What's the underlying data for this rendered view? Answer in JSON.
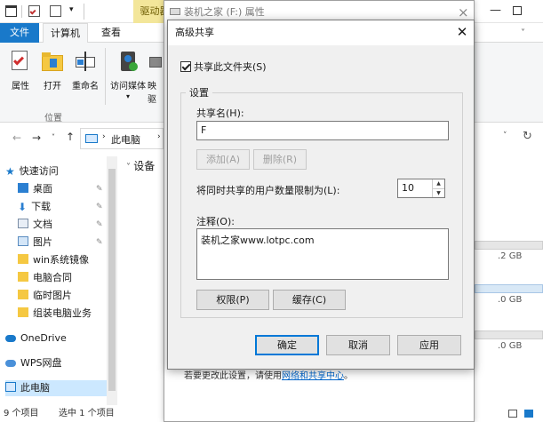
{
  "explorer": {
    "drive_tools_tab": "驱动器",
    "menu": {
      "file": "文件",
      "computer": "计算机",
      "view": "查看"
    },
    "ribbon": {
      "properties": "属性",
      "open": "打开",
      "rename": "重命名",
      "access_media": "访问媒体",
      "map_line1": "映",
      "map_line2": "驱",
      "group_location": "位置"
    },
    "address": {
      "path": "此电脑",
      "section": "设备"
    },
    "nav": {
      "quick_access": "快速访问",
      "desktop": "桌面",
      "downloads": "下载",
      "documents": "文档",
      "pictures": "图片",
      "folder1": "win系统镜像",
      "folder2": "电脑合同",
      "folder3": "临时图片",
      "folder4": "组装电脑业务",
      "onedrive": "OneDrive",
      "wps": "WPS网盘",
      "this_pc": "此电脑"
    },
    "right_sizes": [
      ".2 GB",
      ".0 GB",
      ".0 GB"
    ],
    "status": {
      "items": "9 个项目",
      "selected": "选中 1 个项目"
    }
  },
  "properties": {
    "title": "装机之家 (F:) 属性",
    "tip_prefix": "若要更改此设置，请使用",
    "tip_link": "网络和共享中心",
    "tip_suffix": "。"
  },
  "advanced_share": {
    "title": "高级共享",
    "share_checkbox": "共享此文件夹(S)",
    "settings_group": "设置",
    "share_name_label": "共享名(H):",
    "share_name_value": "F",
    "add_button": "添加(A)",
    "remove_button": "删除(R)",
    "user_limit_label": "将同时共享的用户数量限制为(L):",
    "user_limit_value": "10",
    "comment_label": "注释(O):",
    "comment_value": "装机之家www.lotpc.com",
    "permissions_button": "权限(P)",
    "caching_button": "缓存(C)",
    "ok_button": "确定",
    "cancel_button": "取消",
    "apply_button": "应用"
  },
  "colors": {
    "accent": "#1979ca",
    "drive_tab": "#f3e69a",
    "default_button_border": "#0078d7"
  }
}
